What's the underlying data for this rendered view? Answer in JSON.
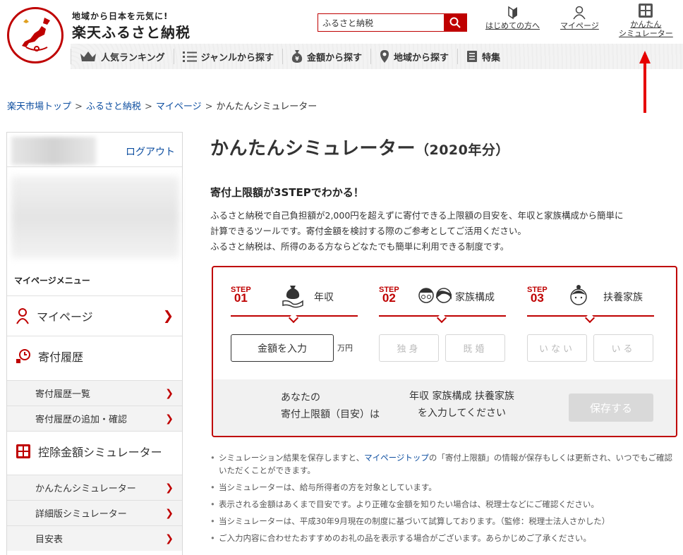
{
  "header": {
    "tagline": "地域から日本を元気に!",
    "brand": "楽天ふるさと納税",
    "search_value": "ふるさと納税",
    "links": {
      "beginner": "はじめての方へ",
      "mypage": "マイページ",
      "simulator_line1": "かんたん",
      "simulator_line2": "シミュレーター"
    },
    "nav": [
      {
        "label": "人気ランキング",
        "icon": "crown-icon"
      },
      {
        "label": "ジャンルから探す",
        "icon": "list-icon"
      },
      {
        "label": "金額から探す",
        "icon": "yen-bag-icon"
      },
      {
        "label": "地域から探す",
        "icon": "map-pin-icon"
      },
      {
        "label": "特集",
        "icon": "document-icon"
      }
    ]
  },
  "breadcrumb": {
    "items": [
      "楽天市場トップ",
      "ふるさと納税",
      "マイページ"
    ],
    "current": "かんたんシミュレーター",
    "sep": ">"
  },
  "sidebar": {
    "logout": "ログアウト",
    "menu_title": "マイページメニュー",
    "items": {
      "mypage": "マイページ",
      "history": "寄付履歴",
      "history_list": "寄付履歴一覧",
      "history_add": "寄付履歴の追加・確認",
      "deduction_sim": "控除金額シミュレーター",
      "easy_sim": "かんたんシミュレーター",
      "detail_sim": "詳細版シミュレーター",
      "guide_table": "目安表"
    }
  },
  "main": {
    "title": "かんたんシミュレーター",
    "title_year": "（2020年分）",
    "subhead": "寄付上限額が3STEPでわかる！",
    "desc": [
      "ふるさと納税で自己負担額が2,000円を超えずに寄付できる上限額の目安を、年収と家族構成から簡単に",
      "計算できるツールです。寄付金額を検討する際のご参考としてご活用ください。",
      "ふるさと納税は、所得のある方ならどなたでも簡単に利用できる制度です。"
    ]
  },
  "simulator": {
    "step_word": "STEP",
    "steps": [
      {
        "num": "01",
        "name": "年収"
      },
      {
        "num": "02",
        "name": "家族構成"
      },
      {
        "num": "03",
        "name": "扶養家族"
      }
    ],
    "amount_button": "金額を入力",
    "yen_unit": "万円",
    "single": "独身",
    "married": "既婚",
    "none": "いない",
    "exists": "いる",
    "result_label_1": "あなたの",
    "result_label_2": "寄付上限額（目安）は",
    "result_msg_1": "年収 家族構成 扶養家族",
    "result_msg_2": "を入力してください",
    "save": "保存する"
  },
  "notes": {
    "n1_a": "シミュレーション結果を保存しますと、",
    "n1_link": "マイページトップ",
    "n1_b": "の「寄付上限額」の情報が保存もしくは更新され、いつでもご確認いただくことができます。",
    "n2": "当シミュレーターは、給与所得者の方を対象としています。",
    "n3": "表示される金額はあくまで目安です。より正確な金額を知りたい場合は、税理士などにご確認ください。",
    "n4": "当シミュレーターは、平成30年9月現在の制度に基づいて試算しております。（監修：税理士法人さかした）",
    "n5": "ご入力内容に合わせたおすすめのお礼の品を表示する場合がございます。あらかじめご了承ください。"
  },
  "colors": {
    "accent": "#bf0000",
    "link": "#0d4ea0"
  }
}
